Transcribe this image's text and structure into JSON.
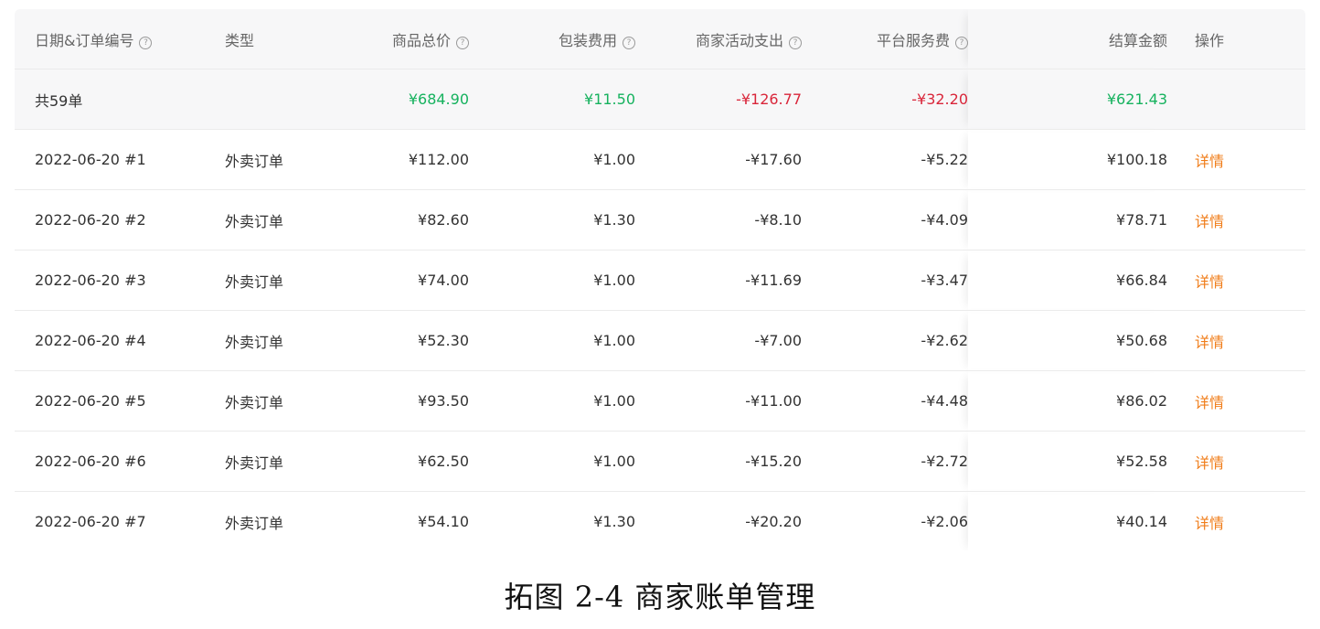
{
  "columns": {
    "date_order": "日期&订单编号",
    "type": "类型",
    "goods_total": "商品总价",
    "packaging": "包装费用",
    "promo": "商家活动支出",
    "service": "平台服务费",
    "settle": "结算金额",
    "action": "操作"
  },
  "summary": {
    "label": "共59单",
    "goods_total": "¥684.90",
    "packaging": "¥11.50",
    "promo": "-¥126.77",
    "service": "-¥32.20",
    "settle": "¥621.43"
  },
  "rows": [
    {
      "date_order": "2022-06-20 #1",
      "type": "外卖订单",
      "goods_total": "¥112.00",
      "packaging": "¥1.00",
      "promo": "-¥17.60",
      "service": "-¥5.22",
      "settle": "¥100.18",
      "action": "详情"
    },
    {
      "date_order": "2022-06-20 #2",
      "type": "外卖订单",
      "goods_total": "¥82.60",
      "packaging": "¥1.30",
      "promo": "-¥8.10",
      "service": "-¥4.09",
      "settle": "¥78.71",
      "action": "详情"
    },
    {
      "date_order": "2022-06-20 #3",
      "type": "外卖订单",
      "goods_total": "¥74.00",
      "packaging": "¥1.00",
      "promo": "-¥11.69",
      "service": "-¥3.47",
      "settle": "¥66.84",
      "action": "详情"
    },
    {
      "date_order": "2022-06-20 #4",
      "type": "外卖订单",
      "goods_total": "¥52.30",
      "packaging": "¥1.00",
      "promo": "-¥7.00",
      "service": "-¥2.62",
      "settle": "¥50.68",
      "action": "详情"
    },
    {
      "date_order": "2022-06-20 #5",
      "type": "外卖订单",
      "goods_total": "¥93.50",
      "packaging": "¥1.00",
      "promo": "-¥11.00",
      "service": "-¥4.48",
      "settle": "¥86.02",
      "action": "详情"
    },
    {
      "date_order": "2022-06-20 #6",
      "type": "外卖订单",
      "goods_total": "¥62.50",
      "packaging": "¥1.00",
      "promo": "-¥15.20",
      "service": "-¥2.72",
      "settle": "¥52.58",
      "action": "详情"
    },
    {
      "date_order": "2022-06-20 #7",
      "type": "外卖订单",
      "goods_total": "¥54.10",
      "packaging": "¥1.30",
      "promo": "-¥20.20",
      "service": "-¥2.06",
      "settle": "¥40.14",
      "action": "详情"
    }
  ],
  "help_icon": "question-circle-icon",
  "colors": {
    "positive": "#16b25e",
    "negative": "#d9263a",
    "link": "#f07d1a"
  },
  "caption": "拓图 2-4  商家账单管理"
}
